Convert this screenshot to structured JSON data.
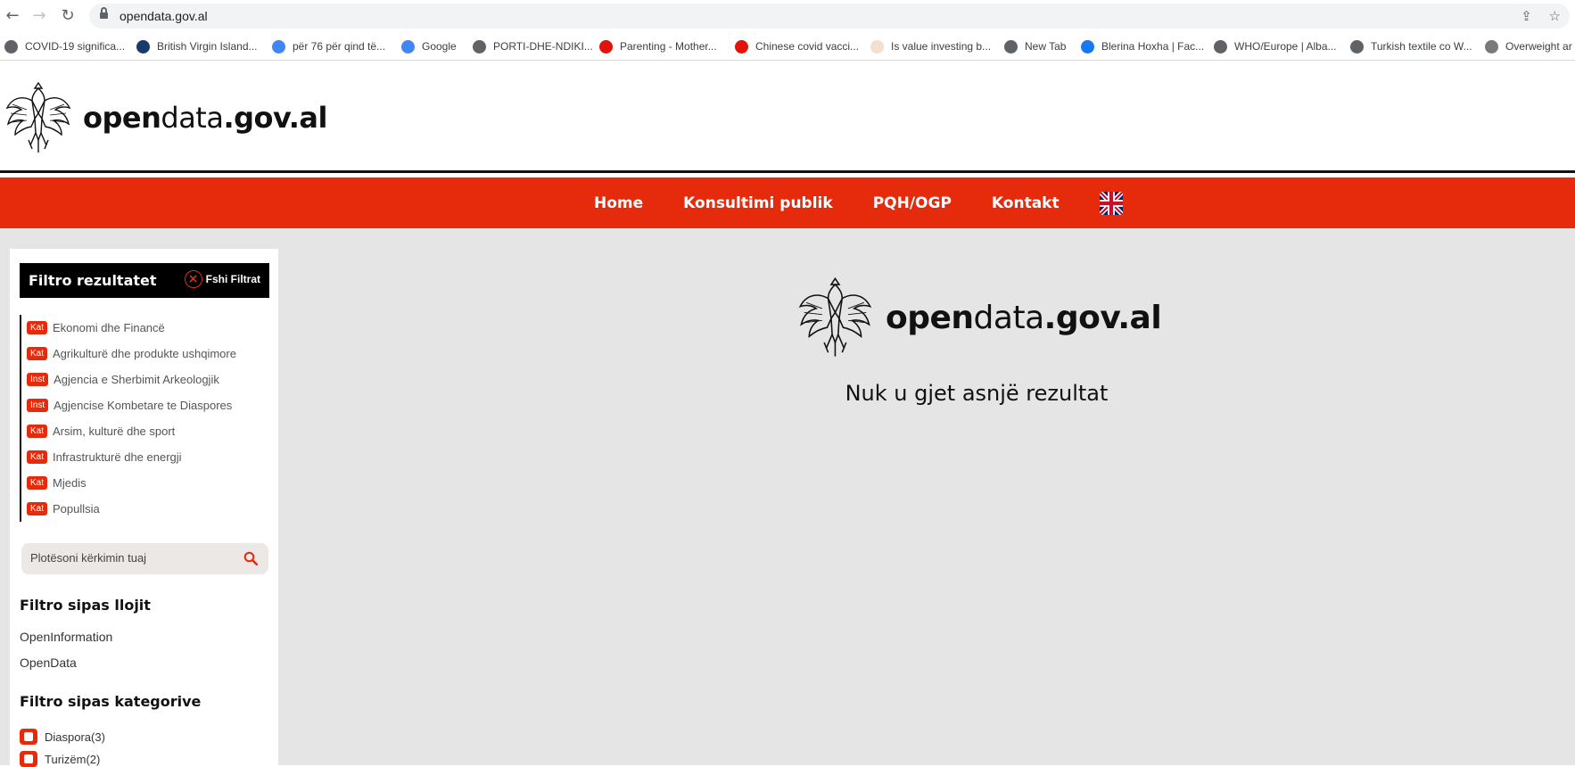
{
  "browser": {
    "url": "opendata.gov.al",
    "bookmarks": [
      {
        "label": "COVID-19 significa...",
        "icon": "globe-icon",
        "color": "#5f6368"
      },
      {
        "label": "British Virgin Island...",
        "icon": "site-icon",
        "color": "#1a3a6b"
      },
      {
        "label": "për 76 për qind të...",
        "icon": "google-icon",
        "color": "#4285f4"
      },
      {
        "label": "Google",
        "icon": "google-icon",
        "color": "#4285f4"
      },
      {
        "label": "PORTI-DHE-NDIKI...",
        "icon": "globe-icon",
        "color": "#5f6368"
      },
      {
        "label": "Parenting - Mother...",
        "icon": "economist-icon",
        "color": "#e3120b"
      },
      {
        "label": "Chinese covid vacci...",
        "icon": "economist-icon",
        "color": "#e3120b"
      },
      {
        "label": "Is value investing b...",
        "icon": "ft-icon",
        "color": "#f2dfce"
      },
      {
        "label": "New Tab",
        "icon": "globe-icon",
        "color": "#5f6368"
      },
      {
        "label": "Blerina Hoxha | Fac...",
        "icon": "facebook-icon",
        "color": "#1877f2"
      },
      {
        "label": "WHO/Europe | Alba...",
        "icon": "who-icon",
        "color": "#5f6368"
      },
      {
        "label": "Turkish textile co W...",
        "icon": "globe-icon",
        "color": "#5f6368"
      },
      {
        "label": "Overweight ar",
        "icon": "site-icon",
        "color": "#7a7a7a"
      }
    ]
  },
  "site": {
    "logo_bold1": "open",
    "logo_thin": "data",
    "logo_bold2": ".gov.al"
  },
  "nav": {
    "items": [
      "Home",
      "Konsultimi publik",
      "PQH/OGP",
      "Kontakt"
    ]
  },
  "sidebar": {
    "filter_title": "Filtro rezultatet",
    "clear_label": "Fshi Filtrat",
    "tags": [
      {
        "tag": "Kat",
        "label": "Ekonomi dhe Financë"
      },
      {
        "tag": "Kat",
        "label": "Agrikulturë dhe produkte ushqimore"
      },
      {
        "tag": "Inst",
        "label": "Agjencia e Sherbimit Arkeologjik"
      },
      {
        "tag": "Inst",
        "label": "Agjencise Kombetare te Diaspores"
      },
      {
        "tag": "Kat",
        "label": "Arsim, kulturë dhe sport"
      },
      {
        "tag": "Kat",
        "label": "Infrastrukturë dhe energji"
      },
      {
        "tag": "Kat",
        "label": "Mjedis"
      },
      {
        "tag": "Kat",
        "label": "Popullsia"
      }
    ],
    "search_placeholder": "Plotësoni kërkimin tuaj",
    "type_title": "Filtro sipas llojit",
    "types": [
      "OpenInformation",
      "OpenData"
    ],
    "category_title": "Filtro sipas kategorive",
    "categories": [
      "Diaspora(3)",
      "Turizëm(2)"
    ]
  },
  "main": {
    "no_result": "Nuk u gjet asnjë rezultat"
  },
  "colors": {
    "accent": "#e52b0c",
    "background": "#e5e5e5"
  }
}
